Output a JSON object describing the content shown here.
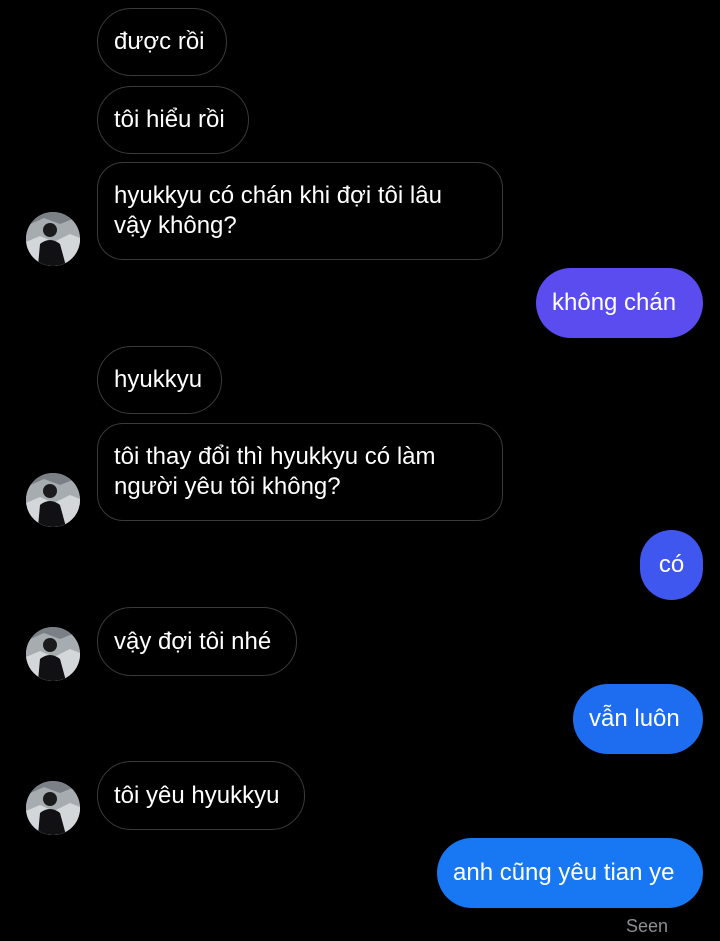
{
  "colors": {
    "background": "#000000",
    "incoming_border": "#3a3a3c",
    "outgoing_purple": "#5b4cf0",
    "outgoing_blue_mid": "#3f57ee",
    "outgoing_blue": "#1e6df0",
    "outgoing_bright_blue": "#1877f2"
  },
  "messages": [
    {
      "side": "incoming",
      "text": "được rồi"
    },
    {
      "side": "incoming",
      "text": "tôi hiểu rồi"
    },
    {
      "side": "incoming",
      "text": "hyukkyu có chán khi đợi tôi lâu vậy không?"
    },
    {
      "side": "outgoing",
      "text": "không chán"
    },
    {
      "side": "incoming",
      "text": "hyukkyu"
    },
    {
      "side": "incoming",
      "text": "tôi thay đổi thì hyukkyu có làm người yêu tôi không?"
    },
    {
      "side": "outgoing",
      "text": "có"
    },
    {
      "side": "incoming",
      "text": "vậy đợi tôi nhé"
    },
    {
      "side": "outgoing",
      "text": "vẫn luôn"
    },
    {
      "side": "incoming",
      "text": "tôi yêu hyukkyu"
    },
    {
      "side": "outgoing",
      "text": "anh cũng yêu tian ye"
    }
  ],
  "status": {
    "seen_label": "Seen"
  },
  "avatar": {
    "icon": "contact-avatar-icon"
  }
}
